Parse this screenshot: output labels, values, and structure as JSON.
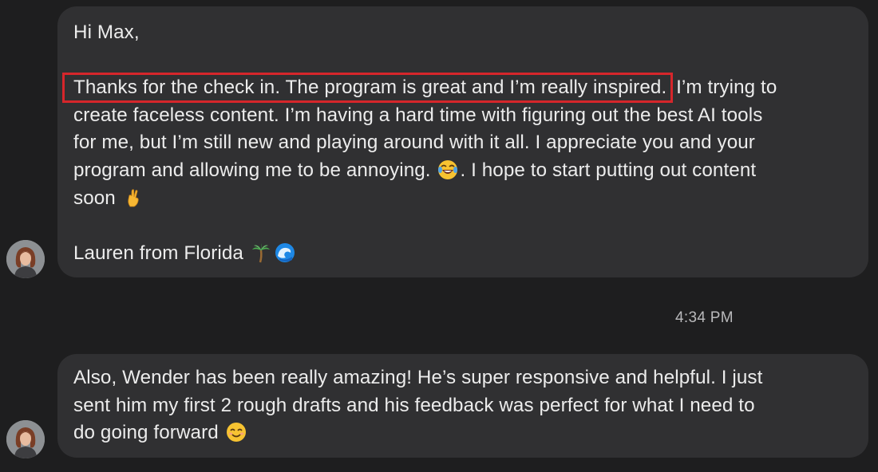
{
  "messages": [
    {
      "greeting": "Hi Max,",
      "highlighted_text": "Thanks for the check in.  The program is great and I’m really inspired.",
      "line1_rest": " I’m trying to",
      "line2": "create faceless content.  I’m having a hard time with figuring out the best AI tools",
      "line3": "for me, but I’m still new and playing around with it all.  I appreciate you and your",
      "line4a": "program and allowing me to be annoying. ",
      "line4b": ". I hope to start putting out content",
      "line5": "soon ",
      "signature": "Lauren from Florida ",
      "emojis": [
        "laughing-crying-emoji",
        "crossed-fingers-emoji",
        "palm-tree-emoji",
        "wave-emoji"
      ],
      "highlight_color": "#d6262b"
    },
    {
      "line1": "Also, Wender has been really amazing!  He’s super responsive and helpful.  I just",
      "line2": "sent him my first 2 rough drafts and his feedback was perfect for what I need to",
      "line3": "do going forward ",
      "emojis": [
        "smiling-face-emoji"
      ]
    }
  ],
  "timestamp": "4:34 PM",
  "colors": {
    "background": "#1e1e1f",
    "bubble": "#303032",
    "text": "#ececec",
    "timestamp": "#b9b9bb"
  }
}
